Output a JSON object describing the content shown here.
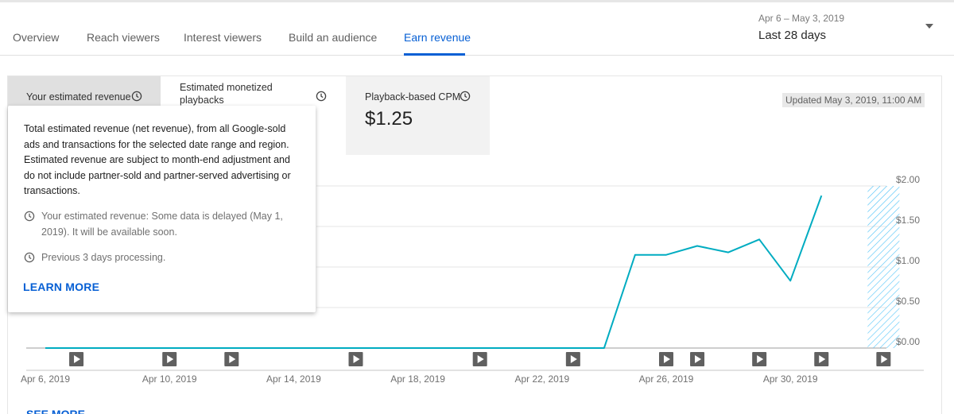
{
  "tabs": [
    {
      "label": "Overview",
      "active": false
    },
    {
      "label": "Reach viewers",
      "active": false
    },
    {
      "label": "Interest viewers",
      "active": false
    },
    {
      "label": "Build an audience",
      "active": false
    },
    {
      "label": "Earn revenue",
      "active": true
    }
  ],
  "date_range": {
    "dates": "Apr 6 – May 3, 2019",
    "label": "Last 28 days"
  },
  "metrics": [
    {
      "label": "Your estimated revenue",
      "selected": true
    },
    {
      "label": "Estimated monetized playbacks",
      "selected": false
    },
    {
      "label": "Playback-based CPM",
      "value": "$1.25",
      "selected": false
    }
  ],
  "updated": "Updated May 3, 2019, 11:00 AM",
  "tooltip": {
    "description": "Total estimated revenue (net revenue), from all Google-sold ads and transactions for the selected date range and region. Estimated revenue are subject to month-end adjustment and do not include partner-sold and partner-served advertising or transactions.",
    "note_delayed": "Your estimated revenue: Some data is delayed (May 1, 2019). It will be available soon.",
    "note_processing": "Previous 3 days processing.",
    "learn_more": "LEARN MORE"
  },
  "see_more": "SEE MORE",
  "colors": {
    "accent": "#065fd4",
    "line": "#00acc1",
    "hatch": "#4fc3f7"
  },
  "chart_data": {
    "type": "line",
    "series_color": "#00acc1",
    "x": [
      "Apr 6",
      "Apr 7",
      "Apr 8",
      "Apr 9",
      "Apr 10",
      "Apr 11",
      "Apr 12",
      "Apr 13",
      "Apr 14",
      "Apr 15",
      "Apr 16",
      "Apr 17",
      "Apr 18",
      "Apr 19",
      "Apr 20",
      "Apr 21",
      "Apr 22",
      "Apr 23",
      "Apr 24",
      "Apr 25",
      "Apr 26",
      "Apr 27",
      "Apr 28",
      "Apr 29",
      "Apr 30",
      "May 1",
      "May 2",
      "May 3"
    ],
    "values": [
      0,
      0,
      0,
      0,
      0,
      0,
      0,
      0,
      0,
      0,
      0,
      0,
      0,
      0,
      0,
      0,
      0,
      0,
      0,
      1.15,
      1.15,
      1.26,
      1.18,
      1.34,
      0.83,
      1.88,
      null,
      null
    ],
    "y_ticks": [
      "$0.00",
      "$0.50",
      "$1.00",
      "$1.50",
      "$2.00"
    ],
    "y_tick_values": [
      0,
      0.5,
      1.0,
      1.5,
      2.0
    ],
    "ylim": [
      0,
      2.0
    ],
    "x_tick_labels": [
      "Apr 6, 2019",
      "Apr 10, 2019",
      "Apr 14, 2019",
      "Apr 18, 2019",
      "Apr 22, 2019",
      "Apr 26, 2019",
      "Apr 30, 2019"
    ],
    "x_tick_indices": [
      0,
      4,
      8,
      12,
      16,
      20,
      24
    ],
    "video_marker_indices": [
      1,
      4,
      6,
      10,
      14,
      17,
      20,
      21,
      23,
      25,
      27
    ],
    "processing_index": 27,
    "grid": true,
    "y_axis_side": "right"
  }
}
